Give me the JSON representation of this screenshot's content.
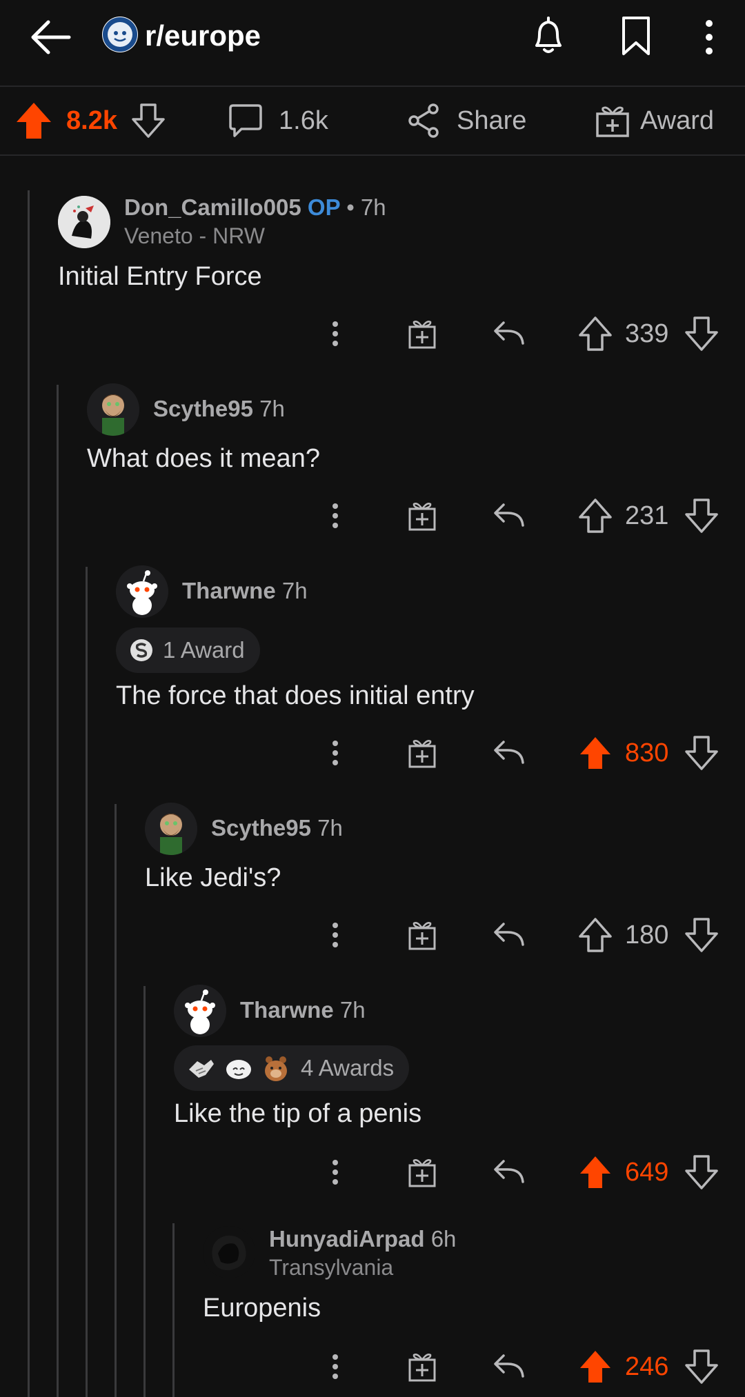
{
  "header": {
    "subreddit": "r/europe"
  },
  "post_actions": {
    "upvotes": "8.2k",
    "comments": "1.6k",
    "share_label": "Share",
    "award_label": "Award"
  },
  "comments": [
    {
      "user": "Don_Camillo005",
      "op_tag": "OP",
      "time": "• 7h",
      "flair": "Veneto - NRW",
      "text": "Initial Entry Force",
      "score": "339",
      "upvoted": false
    },
    {
      "user": "Scythe95",
      "time": "7h",
      "text": "What does it mean?",
      "score": "231",
      "upvoted": false
    },
    {
      "user": "Tharwne",
      "time": "7h",
      "awards": "1 Award",
      "text": "The force that does initial entry",
      "score": "830",
      "upvoted": true
    },
    {
      "user": "Scythe95",
      "time": "7h",
      "text": "Like Jedi's?",
      "score": "180",
      "upvoted": false
    },
    {
      "user": "Tharwne",
      "time": "7h",
      "awards": "4 Awards",
      "text": "Like the tip of a penis",
      "score": "649",
      "upvoted": true
    },
    {
      "user": "HunyadiArpad",
      "time": "6h",
      "flair": "Transylvania",
      "text": "Europenis",
      "score": "246",
      "upvoted": true
    }
  ],
  "colors": {
    "accent_upvote": "#ff4500",
    "op_tag": "#3d8bd9",
    "background": "#111111"
  }
}
